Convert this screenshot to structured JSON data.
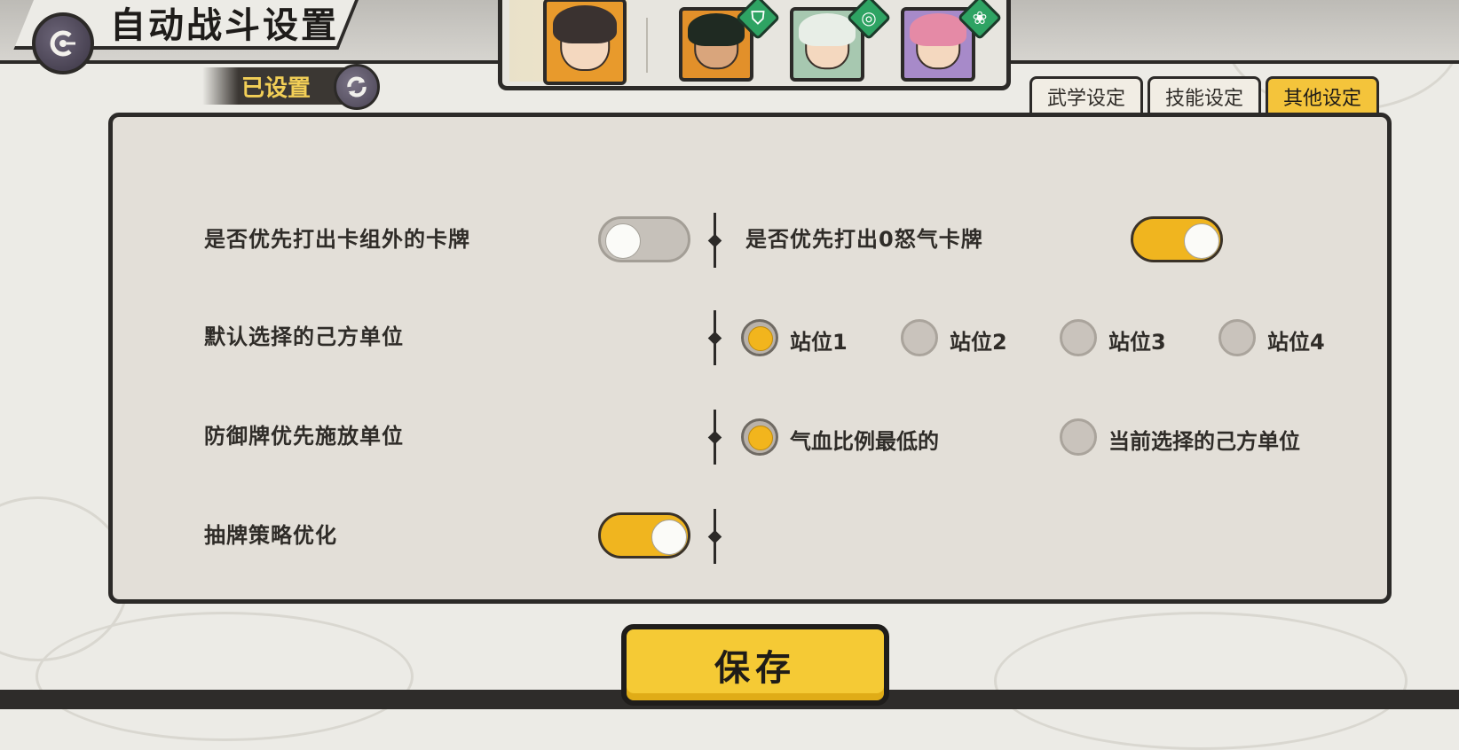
{
  "header": {
    "title": "自动战斗设置"
  },
  "status": {
    "set_label": "已设置"
  },
  "tabs": [
    {
      "label": "武学设定",
      "active": false
    },
    {
      "label": "技能设定",
      "active": false
    },
    {
      "label": "其他设定",
      "active": true
    }
  ],
  "settings": {
    "prioritize_out_of_deck": {
      "label": "是否优先打出卡组外的卡牌",
      "on": false
    },
    "prioritize_zero_rage": {
      "label": "是否优先打出0怒气卡牌",
      "on": true
    },
    "default_unit": {
      "label": "默认选择的己方单位",
      "options": [
        "站位1",
        "站位2",
        "站位3",
        "站位4"
      ],
      "selected": "站位1"
    },
    "defense_target": {
      "label": "防御牌优先施放单位",
      "options": [
        "气血比例最低的",
        "当前选择的己方单位"
      ],
      "selected": "气血比例最低的"
    },
    "draw_optimization": {
      "label": "抽牌策略优化",
      "on": true
    }
  },
  "actions": {
    "save_label": "保存"
  },
  "colors": {
    "accent": "#f2b51d",
    "panel": "#e3dfd8",
    "outline": "#2c2a28"
  }
}
